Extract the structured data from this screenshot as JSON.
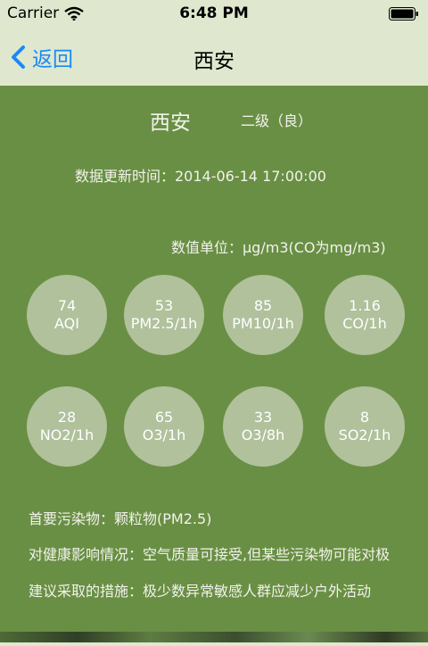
{
  "status_bar": {
    "carrier": "Carrier",
    "time": "6:48 PM",
    "wifi_icon": "wifi-icon",
    "battery_icon": "battery-icon"
  },
  "nav": {
    "back_label": "返回",
    "title": "西安"
  },
  "air": {
    "city": "西安",
    "level": "二级（良）",
    "update_time": "数据更新时间：2014-06-14 17:00:00",
    "unit": "数值单位：μg/m3(CO为mg/m3)",
    "pollutants": [
      {
        "value": "74",
        "label": "AQI"
      },
      {
        "value": "53",
        "label": "PM2.5/1h"
      },
      {
        "value": "85",
        "label": "PM10/1h"
      },
      {
        "value": "1.16",
        "label": "CO/1h"
      },
      {
        "value": "28",
        "label": "NO2/1h"
      },
      {
        "value": "65",
        "label": "O3/1h"
      },
      {
        "value": "33",
        "label": "O3/8h"
      },
      {
        "value": "8",
        "label": "SO2/1h"
      }
    ],
    "primary_pollutant": "首要污染物：颗粒物(PM2.5)",
    "health_effect": "对健康影响情况：空气质量可接受,但某些污染物可能对极",
    "advice": "建议采取的措施：极少数异常敏感人群应减少户外活动"
  },
  "colors": {
    "panel": "#698f44",
    "header": "#dfe8cf",
    "accent": "#1a89f7"
  }
}
